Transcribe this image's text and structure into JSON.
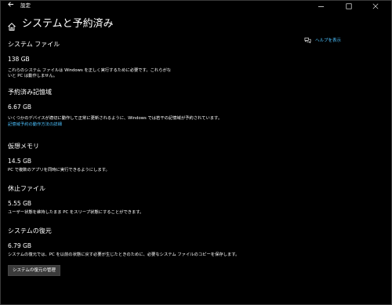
{
  "window": {
    "title": "設定",
    "back_icon": "back-arrow-icon",
    "controls": [
      "minimize-icon",
      "maximize-icon",
      "close-icon"
    ]
  },
  "header": {
    "home_icon": "home-icon",
    "title": "システムと予約済み"
  },
  "help": {
    "icon": "help-chat-icon",
    "label": "ヘルプを表示"
  },
  "sections": [
    {
      "title": "システム ファイル",
      "size": "138 GB",
      "desc_lines": [
        "これらのシステム ファイルは Windows を正しく実行するために必要です。これらがな",
        "いと PC は動作しません。"
      ]
    },
    {
      "title": "予約済み記憶域",
      "size": "6.67 GB",
      "desc_lines": [
        "いくつかのデバイスが適切に動作して正常に更新されるように、Windows では若干の記憶域が予約されています。"
      ],
      "link": "記憶域予約の動作方法の詳細"
    },
    {
      "title": "仮想メモリ",
      "size": "14.5 GB",
      "desc_lines": [
        "PC で複数のアプリを同時に実行できるようにします。"
      ]
    },
    {
      "title": "休止ファイル",
      "size": "5.55 GB",
      "desc_lines": [
        "ユーザー状態を維持したまま PC をスリープ状態にすることができます。"
      ]
    },
    {
      "title": "システムの復元",
      "size": "6.79 GB",
      "desc_lines": [
        "システムの復元では、PC を以前の状態に戻す必要が生じたときのために、必要なシステム ファイルのコピーを保存します。"
      ],
      "button": "システムの復元の管理"
    }
  ],
  "colors": {
    "background": "#000000",
    "text": "#ffffff",
    "link": "#4cc2ff",
    "button_bg": "#3b3b3b"
  }
}
